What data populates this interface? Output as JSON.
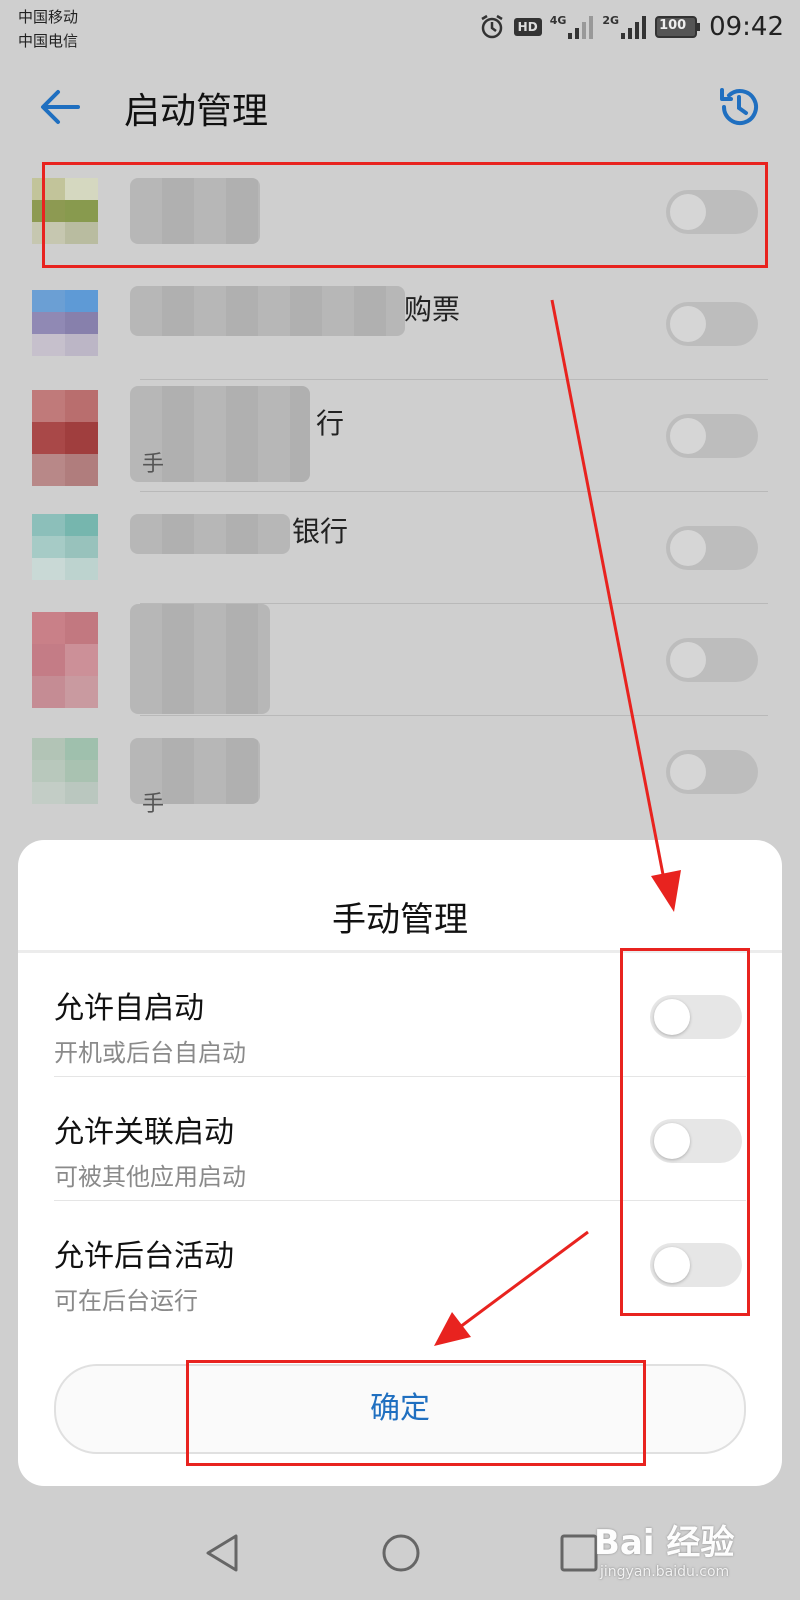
{
  "status_bar": {
    "carrier_1": "中国移动",
    "carrier_2": "中国电信",
    "hd_badge": "HD",
    "network_1": "4G",
    "network_2": "2G",
    "battery": "100",
    "time": "09:42"
  },
  "header": {
    "title": "启动管理"
  },
  "app_list": {
    "rows": [
      {
        "name": "",
        "sub": "",
        "enabled": false
      },
      {
        "name": "购票",
        "sub": "",
        "enabled": false
      },
      {
        "name": "行",
        "sub": "手",
        "enabled": false
      },
      {
        "name": "银行",
        "sub": "",
        "enabled": false
      },
      {
        "name": "",
        "sub": "",
        "enabled": false
      },
      {
        "name": "",
        "sub": "手",
        "enabled": false
      }
    ]
  },
  "dialog": {
    "title": "手动管理",
    "options": [
      {
        "label": "允许自启动",
        "desc": "开机或后台自启动",
        "enabled": false
      },
      {
        "label": "允许关联启动",
        "desc": "可被其他应用启动",
        "enabled": false
      },
      {
        "label": "允许后台活动",
        "desc": "可在后台运行",
        "enabled": false
      }
    ],
    "confirm_label": "确定"
  },
  "watermark": {
    "logo": "Bai 经验",
    "url": "jingyan.baidu.com"
  },
  "colors": {
    "accent": "#1f6fc0",
    "annotation": "#e8231f",
    "overlay": "#cfcfcf"
  }
}
